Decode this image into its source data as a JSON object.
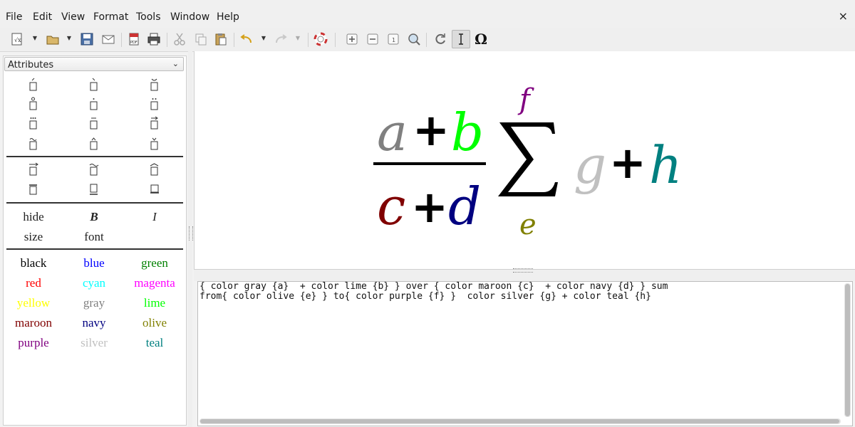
{
  "menu": [
    "File",
    "Edit",
    "View",
    "Format",
    "Tools",
    "Window",
    "Help"
  ],
  "close_symbol": "×",
  "toolbar": {
    "buttons": [
      "new-document-icon",
      "dropdown",
      "open-folder-icon",
      "dropdown",
      "save-icon",
      "email-icon",
      "export-pdf-icon",
      "print-icon",
      "cut-icon",
      "copy-icon",
      "paste-icon",
      "undo-icon",
      "dropdown",
      "redo-icon",
      "dropdown",
      "help-lifebuoy-icon",
      "zoom-in-icon",
      "zoom-out-icon",
      "show-all-icon",
      "zoom-icon",
      "update-icon",
      "formula-cursor-icon",
      "symbols-omega-icon"
    ],
    "omega_label": "Ω"
  },
  "sidebar": {
    "category": "Attributes",
    "formatting_words": [
      "hide",
      "B",
      "I",
      "size",
      "font"
    ],
    "colors": [
      {
        "label": "black",
        "color": "#000000"
      },
      {
        "label": "blue",
        "color": "#0000ff"
      },
      {
        "label": "green",
        "color": "#008000"
      },
      {
        "label": "red",
        "color": "#ff0000"
      },
      {
        "label": "cyan",
        "color": "#00ffff"
      },
      {
        "label": "magenta",
        "color": "#ff00ff"
      },
      {
        "label": "yellow",
        "color": "#ffff00"
      },
      {
        "label": "gray",
        "color": "#808080"
      },
      {
        "label": "lime",
        "color": "#00ff00"
      },
      {
        "label": "maroon",
        "color": "#800000"
      },
      {
        "label": "navy",
        "color": "#000080"
      },
      {
        "label": "olive",
        "color": "#808000"
      },
      {
        "label": "purple",
        "color": "#800080"
      },
      {
        "label": "silver",
        "color": "#c0c0c0"
      },
      {
        "label": "teal",
        "color": "#008080"
      }
    ]
  },
  "formula": {
    "a": "a",
    "b": "b",
    "c": "c",
    "d": "d",
    "e": "e",
    "f": "f",
    "g": "g",
    "h": "h",
    "plus": "+",
    "sum": "∑",
    "colors": {
      "a": "#808080",
      "b": "#00ff00",
      "c": "#800000",
      "d": "#000080",
      "e": "#808000",
      "f": "#800080",
      "g": "#c0c0c0",
      "h": "#008080"
    }
  },
  "editor": {
    "line1": "{ color gray {a}  + color lime {b} } over { color maroon {c}  + color navy {d} } sum",
    "line2": "from{ color olive {e} } to{ color purple {f} }  color silver {g} + color teal {h}"
  }
}
